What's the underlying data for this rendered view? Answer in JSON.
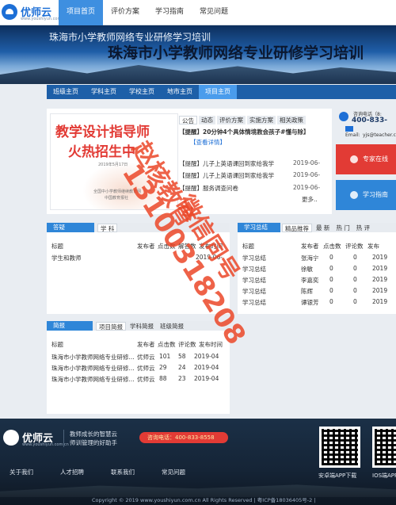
{
  "brand": {
    "name": "优师云",
    "url": "www.youshiyun.com.cn"
  },
  "nav": [
    "项目首页",
    "评价方案",
    "学习指南",
    "常见问题"
  ],
  "banner": {
    "subtitle": "珠海市小学教师网络专业研修学习培训",
    "title": "珠海市小学教师网络专业研修学习培训"
  },
  "subnav": [
    "班级主页",
    "学科主页",
    "学校主页",
    "地市主页",
    "项目主页"
  ],
  "poster": {
    "line1": "教学设计指导师",
    "line2": "火热招生中",
    "small1": "2019年5月17日",
    "small2": "全国中小学教师继续教育网",
    "small3": "中国教育报社"
  },
  "news_tabs": [
    "公告",
    "动态",
    "评价方案",
    "实施方案",
    "相关政策"
  ],
  "news": {
    "headline": "【提醒】20分钟4个具体情境教会孩子#懂与除】",
    "detail": "【查看详情】",
    "rows": [
      {
        "tag": "【提醒】",
        "title": "儿子上英语课回到家给我学",
        "date": "2019-06-"
      },
      {
        "tag": "【提醒】",
        "title": "儿子上英语课回到家给我学",
        "date": "2019-06-"
      },
      {
        "tag": "【提醒】",
        "title": "服务调查问卷",
        "date": "2019-06-"
      }
    ],
    "more": "更多.."
  },
  "contact": {
    "label": "咨询电话（8:",
    "phone": "400-833-",
    "email_label": "Email:",
    "email": "yjs@teacher.c"
  },
  "buttons": {
    "expert": "专家在线",
    "guide": "学习指南"
  },
  "qa": {
    "label": "答疑",
    "tabs": [
      "学 科"
    ],
    "headers": [
      "标题",
      "发布者",
      "点击数",
      "解答数",
      "发布时间"
    ],
    "rows": [
      {
        "title": "学生和教师",
        "date": "2019-06-"
      }
    ]
  },
  "summary": {
    "label": "学习总结",
    "tabs": [
      "精品推荐",
      "最 新",
      "热 门",
      "热 评"
    ],
    "headers": [
      "标题",
      "发布者",
      "点击数",
      "评论数",
      "发布"
    ],
    "rows": [
      {
        "title": "学习总结",
        "author": "张海宁",
        "clicks": "0",
        "comments": "0",
        "date": "2019"
      },
      {
        "title": "学习总结",
        "author": "徐敏",
        "clicks": "0",
        "comments": "0",
        "date": "2019"
      },
      {
        "title": "学习总结",
        "author": "李嘉奕",
        "clicks": "0",
        "comments": "0",
        "date": "2019"
      },
      {
        "title": "学习总结",
        "author": "陈辉",
        "clicks": "0",
        "comments": "0",
        "date": "2019"
      },
      {
        "title": "学习总结",
        "author": "谭银芳",
        "clicks": "0",
        "comments": "0",
        "date": "2019"
      }
    ]
  },
  "briefing": {
    "label": "简报",
    "tabs": [
      "项目简报",
      "学科简报",
      "班级简报"
    ],
    "headers": [
      "标题",
      "发布者",
      "点击数",
      "评论数",
      "发布时间"
    ],
    "rows": [
      {
        "title": "珠海市小学教师网络专业研修...",
        "author": "优师云",
        "clicks": "101",
        "comments": "58",
        "date": "2019-04"
      },
      {
        "title": "珠海市小学教师网络专业研修...",
        "author": "优师云",
        "clicks": "29",
        "comments": "24",
        "date": "2019-04"
      },
      {
        "title": "珠海市小学教师网络专业研修...",
        "author": "优师云",
        "clicks": "88",
        "comments": "23",
        "date": "2019-04"
      }
    ]
  },
  "watermark": {
    "line1": "赵核教育",
    "line2": "13100318208",
    "line3": "微信同号"
  },
  "footer": {
    "slogan1": "教师成长的智慧云",
    "slogan2": "师训管理的好助手",
    "hotline": "咨询电话：400-833-8558",
    "links": [
      "关于我们",
      "人才招聘",
      "联系我们",
      "常见问题"
    ],
    "app1": "安卓端APP下载",
    "app2": "IOS端APP",
    "copyright": "Copyright © 2019 www.youshiyun.com.cn All Rights Reserved | 粤ICP备18036405号-2 |"
  },
  "colors": {
    "primary": "#1d6fd6",
    "accent_red": "#e23b35",
    "watermark": "#eb4628"
  }
}
